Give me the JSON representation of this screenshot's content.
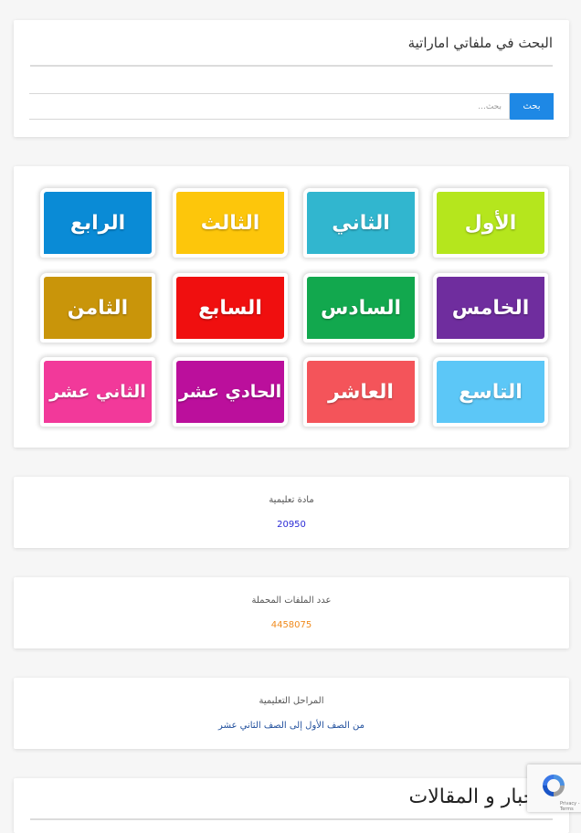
{
  "search": {
    "title": "البحث في ملفاتي اماراتية",
    "placeholder": "بحث...",
    "button_label": "بحث"
  },
  "grades": [
    {
      "label": "الأول",
      "color": "#b5e61d"
    },
    {
      "label": "الثاني",
      "color": "#31b6cf"
    },
    {
      "label": "الثالث",
      "color": "#fdc60b"
    },
    {
      "label": "الرابع",
      "color": "#0a8bd6"
    },
    {
      "label": "الخامس",
      "color": "#6f2d9e"
    },
    {
      "label": "السادس",
      "color": "#12a84e"
    },
    {
      "label": "السابع",
      "color": "#f00f0f"
    },
    {
      "label": "الثامن",
      "color": "#c9950a"
    },
    {
      "label": "التاسع",
      "color": "#5cc7f7"
    },
    {
      "label": "العاشر",
      "color": "#f4545a"
    },
    {
      "label": "الحادي عشر",
      "color": "#bb0f9c"
    },
    {
      "label": "الثاني عشر",
      "color": "#f2399a"
    }
  ],
  "stats": [
    {
      "label": "مادة تعليمية",
      "value": "20950",
      "color": "#2b2bd6"
    },
    {
      "label": "عدد الملفات المحملة",
      "value": "4458075",
      "color": "#f08a1c"
    },
    {
      "label": "المراحل التعليمية",
      "value": "من الصف الأول إلى الصف الثاني عشر",
      "color": "#1f4e9c"
    }
  ],
  "news": {
    "title": "الأخبار و المقالات"
  },
  "recaptcha": {
    "text": "Privacy - Terms"
  }
}
